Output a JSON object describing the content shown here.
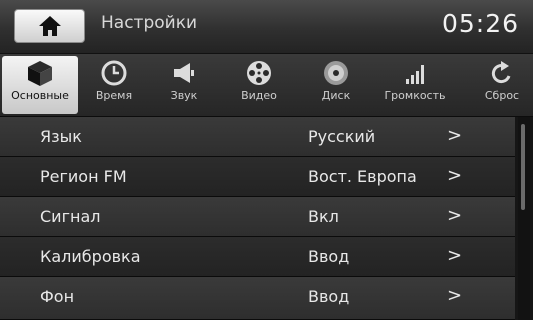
{
  "header": {
    "title": "Настройки",
    "time": "05:26",
    "home_icon": "home-icon"
  },
  "tabs": [
    {
      "label": "Основные",
      "icon": "cube-icon",
      "active": true
    },
    {
      "label": "Время",
      "icon": "clock-icon",
      "active": false
    },
    {
      "label": "Звук",
      "icon": "speaker-icon",
      "active": false
    },
    {
      "label": "Видео",
      "icon": "film-reel-icon",
      "active": false
    },
    {
      "label": "Диск",
      "icon": "disc-icon",
      "active": false
    },
    {
      "label": "Громкость",
      "icon": "volume-bars-icon",
      "active": false
    },
    {
      "label": "Сброс",
      "icon": "reset-icon",
      "active": false
    }
  ],
  "settings": [
    {
      "name": "Язык",
      "value": "Русский",
      "arrow": ">"
    },
    {
      "name": "Регион FM",
      "value": "Вост. Европа",
      "arrow": ">"
    },
    {
      "name": "Сигнал",
      "value": "Вкл",
      "arrow": ">"
    },
    {
      "name": "Калибровка",
      "value": "Ввод",
      "arrow": ">"
    },
    {
      "name": "Фон",
      "value": "Ввод",
      "arrow": ">"
    }
  ],
  "colors": {
    "background": "#161616",
    "active_tab": "#e6e6e6",
    "text": "#e8e8e8"
  }
}
